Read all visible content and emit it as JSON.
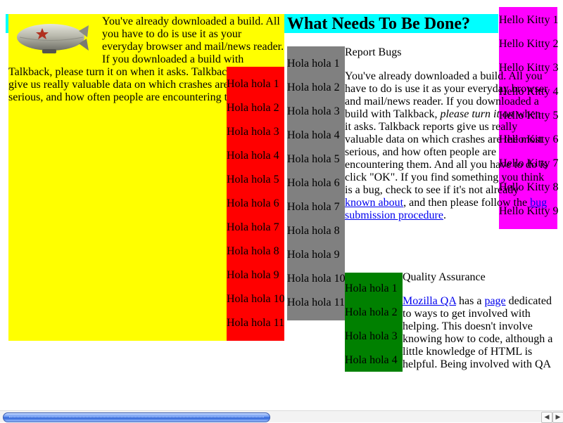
{
  "intro_paragraph": "You've already downloaded a build. All you have to do is use it as your everyday browser and mail/news reader. If you downloaded a build with Talkback, please turn it on when it asks. Talkback reports give us really valuable data on which crashes are the most serious, and how often people are encountering them.",
  "heading": "What Needs To Be Done?",
  "red_items": [
    "Hola hola 1",
    "Hola hola 2",
    "Hola hola 3",
    "Hola hola 4",
    "Hola hola 5",
    "Hola hola 6",
    "Hola hola 7",
    "Hola hola 8",
    "Hola hola 9",
    "Hola hola 10",
    "Hola hola 11"
  ],
  "grey_items": [
    "Hola hola 1",
    "Hola hola 2",
    "Hola hola 3",
    "Hola hola 4",
    "Hola hola 5",
    "Hola hola 6",
    "Hola hola 7",
    "Hola hola 8",
    "Hola hola 9",
    "Hola hola 10",
    "Hola hola 11"
  ],
  "green_items": [
    "Hola hola 1",
    "Hola hola 2",
    "Hola hola 3",
    "Hola hola 4"
  ],
  "magenta_items": [
    "Hello Kitty 1",
    "Hello Kitty 2",
    "Hello Kitty 3",
    "Hello Kitty 4",
    "Hello Kitty 5",
    "Hello Kitty 6",
    "Hello Kitty 7",
    "Hello Kitty 8",
    "Hello Kitty 9"
  ],
  "report": {
    "title": "Report Bugs",
    "text_1": "You've already downloaded a build. All you have to do is use it as your everyday browser and mail/news reader. If you downloaded a build with Talkback, ",
    "emphasis": "please turn it on",
    "text_2": " when it asks. Talkback reports give us really valuable data on which crashes are the most serious, and how often people are encountering them. And all you have to do is click \"OK\". If you find something you think is a bug, check to see if it's not already ",
    "link_known": "known about",
    "text_3": ", and then please follow the ",
    "link_procedure": "bug submission procedure",
    "text_4": "."
  },
  "qa": {
    "title": "Quality Assurance",
    "link_mozilla_qa": "Mozilla QA",
    "text_1": " has a ",
    "link_page": "page",
    "text_2": " dedicated to ways to get involved with helping. This doesn't involve knowing how to code, although a little knowledge of HTML is helpful. Being involved with QA"
  },
  "icons": {
    "zeppelin": "zeppelin-image",
    "scroll_left": "arrow-left-icon",
    "scroll_right": "arrow-right-icon"
  },
  "scrollbar": {
    "position": 0
  }
}
